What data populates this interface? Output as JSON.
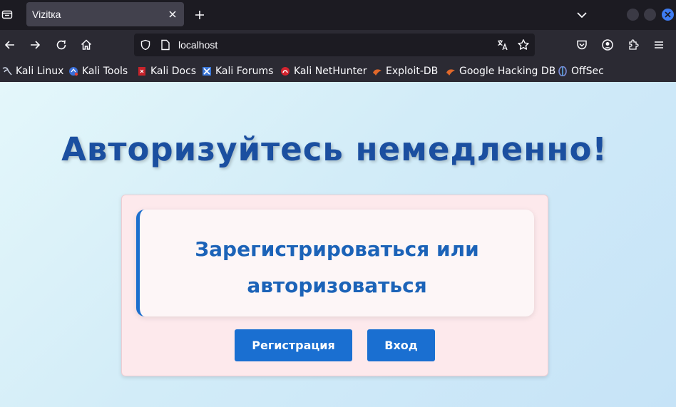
{
  "browser": {
    "tab": {
      "title": "Vizitка"
    },
    "url": "localhost",
    "bookmarks": [
      {
        "label": "Kali Linux",
        "icon": "kali-dragon-icon"
      },
      {
        "label": "Kali Tools",
        "icon": "kali-tools-icon"
      },
      {
        "label": "Kali Docs",
        "icon": "kali-docs-icon"
      },
      {
        "label": "Kali Forums",
        "icon": "kali-forums-icon"
      },
      {
        "label": "Kali NetHunter",
        "icon": "nethunter-icon"
      },
      {
        "label": "Exploit-DB",
        "icon": "exploit-db-icon"
      },
      {
        "label": "Google Hacking DB",
        "icon": "ghdb-icon"
      },
      {
        "label": "OffSec",
        "icon": "offsec-icon"
      }
    ],
    "colors": {
      "tab_bg": "#42414d",
      "toolbar_bg": "#2b2a33",
      "close_button": "#3e7bf0"
    }
  },
  "page": {
    "heading": "Авторизуйтесь немедленно!",
    "card_text": "Зарегистрироваться или авторизоваться",
    "buttons": {
      "register": "Регистрация",
      "login": "Вход"
    },
    "colors": {
      "heading": "#1b4fa0",
      "button": "#1a6fd1",
      "card_bg": "#fde9ec",
      "accent": "#1c6fcd"
    }
  }
}
